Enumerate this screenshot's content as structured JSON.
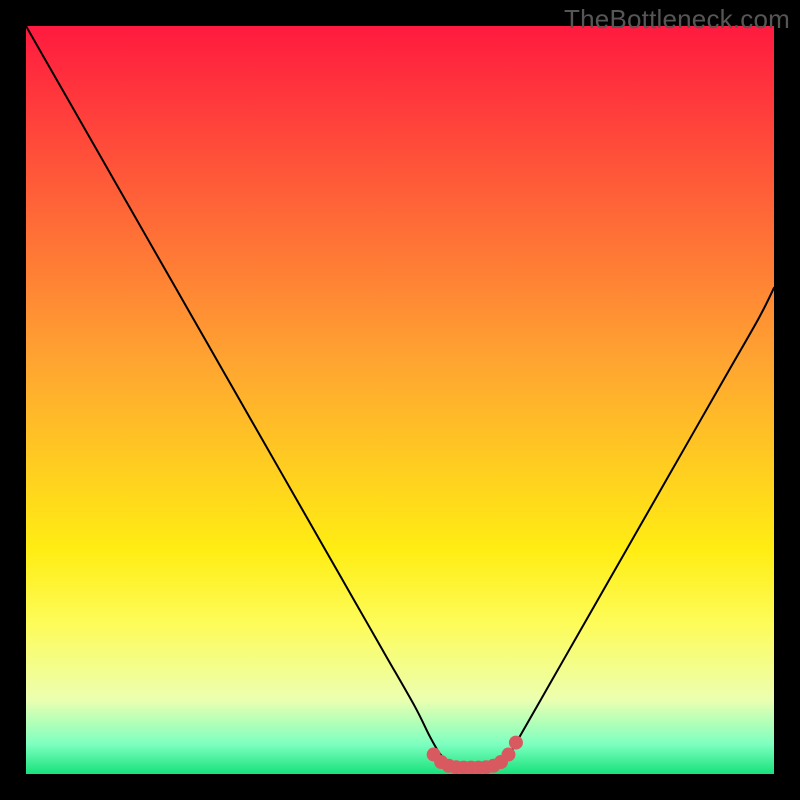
{
  "watermark": "TheBottleneck.com",
  "chart_data": {
    "type": "line",
    "title": "",
    "xlabel": "",
    "ylabel": "",
    "xlim": [
      0,
      100
    ],
    "ylim": [
      0,
      100
    ],
    "background_gradient_stops": [
      {
        "pos": 0.0,
        "color": "#ff1a3f"
      },
      {
        "pos": 0.45,
        "color": "#ffa531"
      },
      {
        "pos": 0.7,
        "color": "#ffed13"
      },
      {
        "pos": 0.8,
        "color": "#fdfc5a"
      },
      {
        "pos": 0.9,
        "color": "#ecffb0"
      },
      {
        "pos": 0.96,
        "color": "#7dffc0"
      },
      {
        "pos": 1.0,
        "color": "#18e27b"
      }
    ],
    "series": [
      {
        "name": "bottleneck-curve",
        "color": "#000000",
        "x": [
          0,
          4,
          8,
          12,
          16,
          20,
          24,
          28,
          32,
          36,
          40,
          44,
          48,
          52,
          54,
          55.5,
          57,
          58.5,
          60,
          61.5,
          63,
          64.5,
          66,
          70,
          74,
          78,
          82,
          86,
          90,
          94,
          98,
          100
        ],
        "y": [
          100,
          93,
          86,
          79,
          72,
          65,
          58,
          51,
          44,
          37,
          30,
          23,
          16,
          9,
          5,
          2.5,
          1.5,
          1,
          1,
          1,
          1.5,
          2.5,
          5,
          12,
          19,
          26,
          33,
          40,
          47,
          54,
          61,
          65
        ]
      }
    ],
    "highlight": {
      "name": "trough-markers",
      "color": "#d85a60",
      "marker_radius_px": 7,
      "x": [
        54.5,
        55.5,
        56.5,
        57.5,
        58.5,
        59.5,
        60.5,
        61.5,
        62.5,
        63.5,
        64.5,
        65.5
      ],
      "y": [
        2.6,
        1.6,
        1.1,
        0.9,
        0.85,
        0.85,
        0.85,
        0.9,
        1.1,
        1.6,
        2.6,
        4.2
      ]
    }
  }
}
